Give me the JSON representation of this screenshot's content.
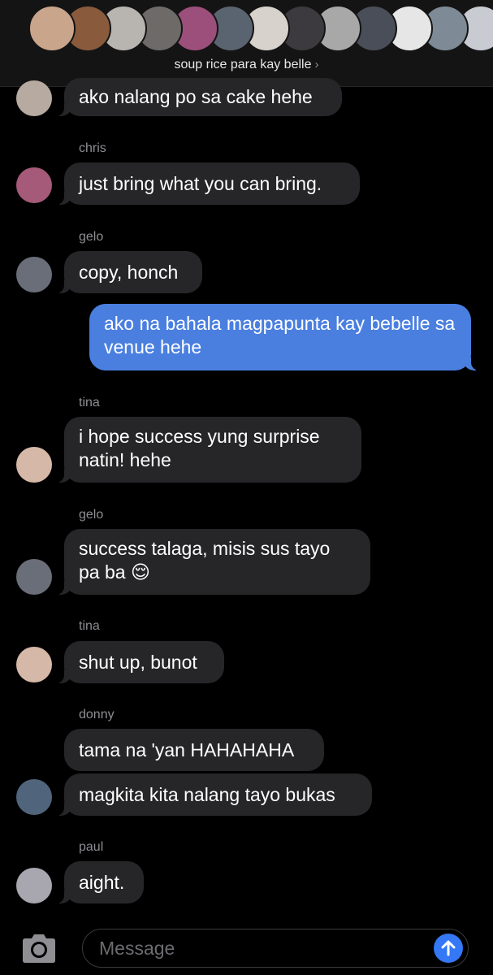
{
  "header": {
    "group_name": "soup rice para kay belle",
    "chevron": "›",
    "member_avatars": [
      {
        "initial": "",
        "color": "#c9a58c"
      },
      {
        "initial": "",
        "color": "#8a5a3c"
      },
      {
        "initial": "",
        "color": "#b8b4b0"
      },
      {
        "initial": "",
        "color": "#6e6a68"
      },
      {
        "initial": "",
        "color": "#9c4f7a"
      },
      {
        "initial": "",
        "color": "#5a6470"
      },
      {
        "initial": "",
        "color": "#d8d2cc"
      },
      {
        "initial": "",
        "color": "#3c3a3e"
      },
      {
        "initial": "",
        "color": "#a8a8a8"
      },
      {
        "initial": "",
        "color": "#4a4e58"
      },
      {
        "initial": "",
        "color": "#e6e6e6"
      },
      {
        "initial": "",
        "color": "#7e8a96"
      },
      {
        "initial": "",
        "color": "#c8ccd2"
      }
    ]
  },
  "messages": {
    "m0": {
      "text": "ako nalang po sa cake hehe",
      "avatar_color": "#b7aaa0"
    },
    "m1": {
      "sender": "chris",
      "text": "just bring what you can bring.",
      "avatar_color": "#a45a78"
    },
    "m2": {
      "sender": "gelo",
      "text": "copy, honch",
      "avatar_color": "#6a6e78"
    },
    "m3": {
      "text": "ako na bahala magpapunta kay bebelle sa venue hehe"
    },
    "m4": {
      "sender": "tina",
      "text": "i hope success yung surprise natin! hehe",
      "avatar_color": "#d6b8a8"
    },
    "m5": {
      "sender": "gelo",
      "text": "success talaga, misis sus tayo pa ba 😌",
      "avatar_color": "#6a6e78"
    },
    "m6": {
      "sender": "tina",
      "text": "shut up, bunot",
      "avatar_color": "#d6b8a8"
    },
    "m7": {
      "sender": "donny",
      "text": "tama na 'yan HAHAHAHA"
    },
    "m8": {
      "text": "magkita kita nalang tayo bukas",
      "avatar_color": "#50647c"
    },
    "m9": {
      "sender": "paul",
      "text": "aight.",
      "avatar_color": "#a8a6ae"
    }
  },
  "composer": {
    "placeholder": "Message",
    "value": ""
  },
  "colors": {
    "incoming_bubble": "#262628",
    "outgoing_bubble": "#4a7fe0",
    "send_button": "#3478f6"
  }
}
